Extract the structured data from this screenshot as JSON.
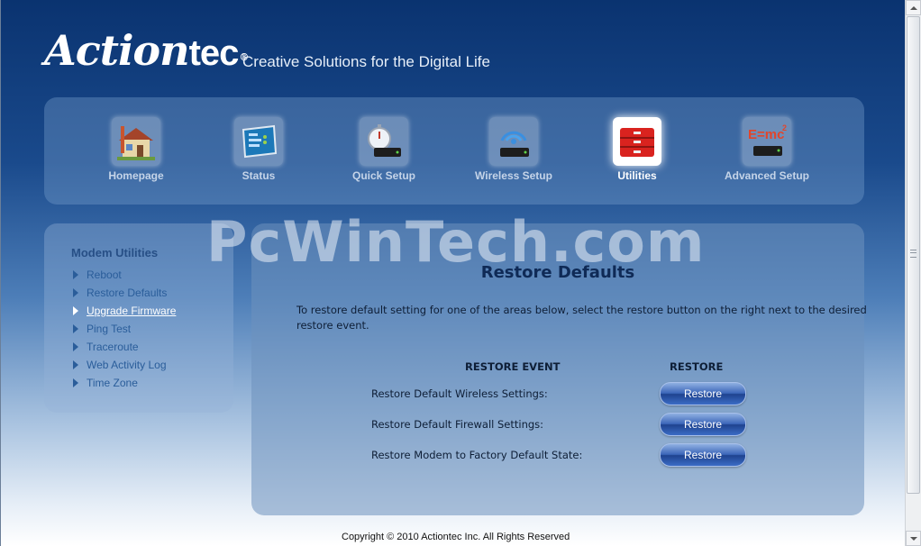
{
  "header": {
    "logo_main": "Action",
    "logo_tec": "tec",
    "logo_reg": "®",
    "tagline": "Creative Solutions for the Digital Life"
  },
  "nav": {
    "items": [
      {
        "label": "Homepage",
        "icon": "house-icon"
      },
      {
        "label": "Status",
        "icon": "status-monitor-icon"
      },
      {
        "label": "Quick Setup",
        "icon": "stopwatch-modem-icon"
      },
      {
        "label": "Wireless Setup",
        "icon": "wireless-modem-icon"
      },
      {
        "label": "Utilities",
        "icon": "toolbox-icon",
        "active": true
      },
      {
        "label": "Advanced Setup",
        "icon": "emc2-modem-icon"
      }
    ]
  },
  "sidebar": {
    "title": "Modem Utilities",
    "items": [
      {
        "label": "Reboot"
      },
      {
        "label": "Restore Defaults"
      },
      {
        "label": "Upgrade Firmware",
        "current": true
      },
      {
        "label": "Ping Test"
      },
      {
        "label": "Traceroute"
      },
      {
        "label": "Web Activity Log"
      },
      {
        "label": "Time Zone"
      }
    ]
  },
  "watermark": "PcWinTech.com",
  "main": {
    "title": "Restore Defaults",
    "intro": "To restore default setting for one of the areas below, select the restore button on the right next to the desired restore event.",
    "col_event": "RESTORE EVENT",
    "col_restore": "RESTORE",
    "rows": [
      {
        "label": "Restore Default Wireless Settings:",
        "button": "Restore"
      },
      {
        "label": "Restore Default Firewall Settings:",
        "button": "Restore"
      },
      {
        "label": "Restore Modem to Factory Default State:",
        "button": "Restore"
      }
    ]
  },
  "footer": {
    "copyright": "Copyright © 2010 Actiontec Inc. All Rights Reserved"
  },
  "colors": {
    "header_blue": "#0a3370",
    "link_blue": "#2a5d9a",
    "title_navy": "#0f2a56",
    "button_blue": "#3b65b8"
  }
}
